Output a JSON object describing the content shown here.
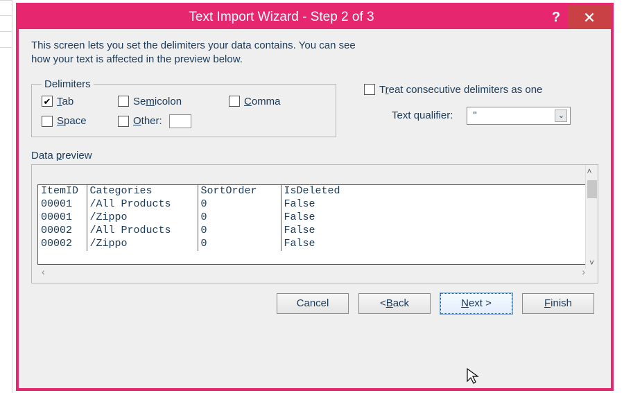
{
  "window": {
    "title": "Text Import Wizard - Step 2 of 3"
  },
  "instructions": {
    "line1": "This screen lets you set the delimiters your data contains.  You can see",
    "line2": "how your text is affected in the preview below."
  },
  "delimiters": {
    "legend": "Delimiters",
    "tab": {
      "label_pre": "",
      "ul": "T",
      "label_post": "ab",
      "checked": true
    },
    "semicolon": {
      "label_pre": "Se",
      "ul": "m",
      "label_post": "icolon",
      "checked": false
    },
    "comma": {
      "ul": "C",
      "label_post": "omma",
      "checked": false
    },
    "space": {
      "ul": "S",
      "label_post": "pace",
      "checked": false
    },
    "other": {
      "ul": "O",
      "label_post": "ther:",
      "checked": false,
      "value": ""
    }
  },
  "treat": {
    "label_pre": "T",
    "ul": "r",
    "label_post": "eat consecutive delimiters as one",
    "checked": false
  },
  "qualifier": {
    "label_pre": "Text ",
    "ul": "q",
    "label_post": "ualifier:",
    "value": "\""
  },
  "preview": {
    "label_pre": "Data ",
    "ul": "p",
    "label_post": "review",
    "headers": [
      "ItemID",
      "Categories",
      "SortOrder",
      "IsDeleted"
    ],
    "rows": [
      [
        "00001",
        "/All Products",
        "0",
        "False"
      ],
      [
        "00001",
        "/Zippo",
        "0",
        "False"
      ],
      [
        "00002",
        "/All Products",
        "0",
        "False"
      ],
      [
        "00002",
        "/Zippo",
        "0",
        "False"
      ]
    ]
  },
  "buttons": {
    "cancel": "Cancel",
    "back_pre": "< ",
    "back_ul": "B",
    "back_post": "ack",
    "next_ul": "N",
    "next_post": "ext >",
    "finish_ul": "F",
    "finish_post": "inish"
  }
}
